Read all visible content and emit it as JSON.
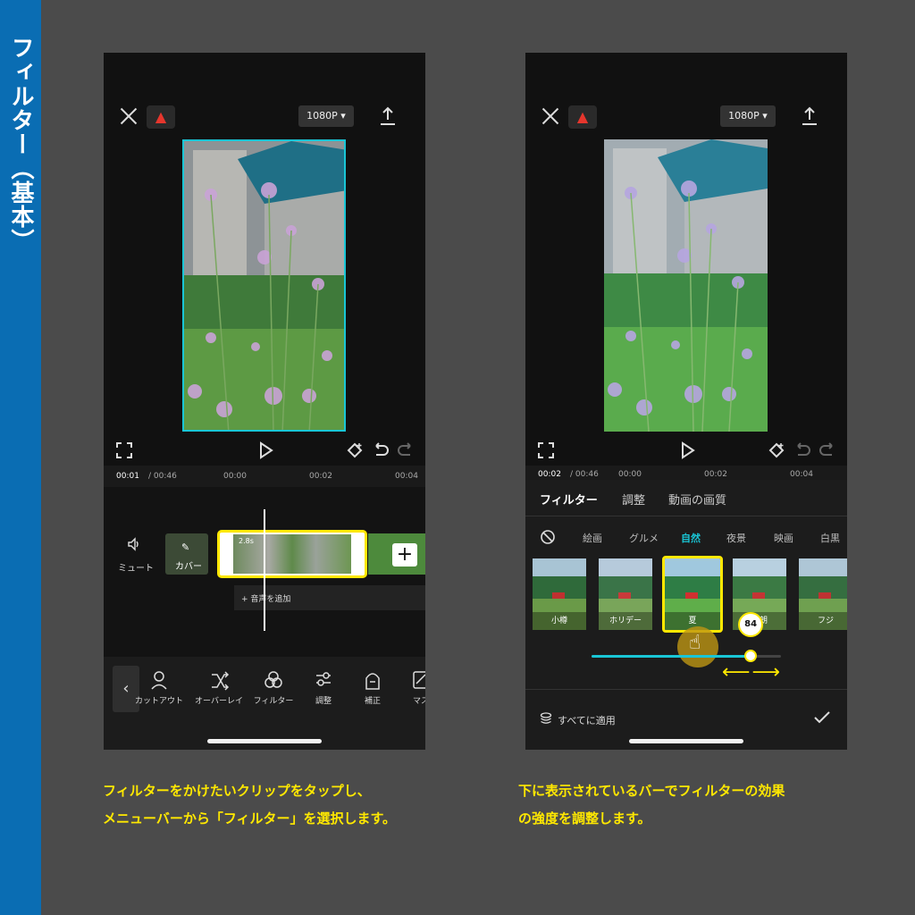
{
  "sidebar": {
    "title": "フィルター（基本）"
  },
  "top_bar": {
    "resolution": "1080P"
  },
  "screen1": {
    "time_current": "00:01",
    "time_total": "/ 00:46",
    "ticks": [
      "00:00",
      "00:02",
      "00:04"
    ],
    "mute_label": "ミュート",
    "cover_label": "カバー",
    "clip_duration": "2.8s",
    "add_audio": "+ 音声を追加",
    "tools": [
      {
        "label": "カットアウト",
        "icon": "cutout-icon"
      },
      {
        "label": "オーバーレイ",
        "icon": "shuffle-icon"
      },
      {
        "label": "フィルター",
        "icon": "filter-icon"
      },
      {
        "label": "調整",
        "icon": "sliders-icon"
      },
      {
        "label": "補正",
        "icon": "retouch-icon"
      },
      {
        "label": "マス",
        "icon": "mask-icon"
      }
    ]
  },
  "screen2": {
    "time_current": "00:02",
    "time_total": "/ 00:46",
    "ticks": [
      "00:00",
      "00:02",
      "00:04"
    ],
    "tabs": [
      "フィルター",
      "調整",
      "動画の画質"
    ],
    "categories": [
      "絵画",
      "グルメ",
      "自然",
      "夜景",
      "映画",
      "白黒"
    ],
    "active_category": "自然",
    "thumbnails": [
      "小樽",
      "ホリデー",
      "夏",
      "晴朗",
      "フジ"
    ],
    "selected_thumbnail": "夏",
    "intensity": 84,
    "intensity_label": "84",
    "apply_all": "すべてに適用"
  },
  "captions": {
    "left": "フィルターをかけたいクリップをタップし、\nメニューバーから「フィルター」を選択します。",
    "right": "下に表示されているバーでフィルターの効果\nの強度を調整します。"
  },
  "colors": {
    "accent_blue": "#0a6db3",
    "highlight_yellow": "#ffe800",
    "teal": "#19c6d6"
  }
}
